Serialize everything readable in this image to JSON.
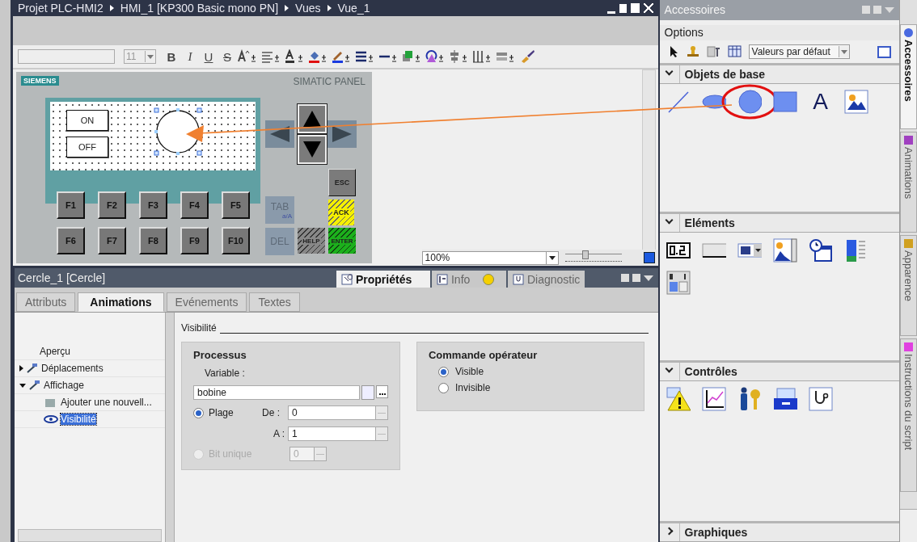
{
  "title_bar": {
    "breadcrumb": [
      "Projet PLC-HMI2",
      "HMI_1 [KP300 Basic mono PN]",
      "Vues",
      "Vue_1"
    ]
  },
  "toolbar": {
    "font_size": "11",
    "text_styles": [
      "B",
      "I",
      "U",
      "S"
    ],
    "tools": [
      {
        "kind": "grow-font"
      },
      {
        "kind": "align-text"
      },
      {
        "kind": "font-color"
      },
      {
        "kind": "fill-color"
      },
      {
        "kind": "line-color"
      },
      {
        "kind": "line-width"
      },
      {
        "kind": "line-style"
      },
      {
        "kind": "layer"
      },
      {
        "kind": "rotate"
      },
      {
        "kind": "align"
      },
      {
        "kind": "distribute"
      },
      {
        "kind": "size"
      },
      {
        "kind": "brush"
      }
    ]
  },
  "hmi_panel": {
    "brand": "SIEMENS",
    "model": "SIMATIC PANEL",
    "screen_buttons": [
      "ON",
      "OFF"
    ],
    "circle_selected": true,
    "function_keys": [
      "F1",
      "F2",
      "F3",
      "F4",
      "F5",
      "F6",
      "F7",
      "F8",
      "F9",
      "F10"
    ],
    "keys": [
      {
        "kind": "esc",
        "label": "ESC"
      },
      {
        "kind": "ack",
        "label": "ACK"
      },
      {
        "kind": "tab",
        "label": "TAB",
        "sub": "a/A"
      },
      {
        "kind": "del",
        "label": "DEL"
      },
      {
        "kind": "help",
        "label": "HELP"
      },
      {
        "kind": "enter",
        "label": "ENTER"
      }
    ]
  },
  "zoom": {
    "value": "100%",
    "level": 0.35
  },
  "properties": {
    "object": "Cercle_1 [Cercle]",
    "panel_tabs": [
      {
        "label": "Propriétés",
        "selected": true
      },
      {
        "label": "Info",
        "selected": false
      },
      {
        "label": "Diagnostic",
        "selected": false
      }
    ],
    "tabs": [
      {
        "label": "Attributs",
        "selected": false
      },
      {
        "label": "Animations",
        "selected": true
      },
      {
        "label": "Evénements",
        "selected": false
      },
      {
        "label": "Textes",
        "selected": false
      }
    ],
    "tree": [
      {
        "label": "Aperçu",
        "selected": false
      },
      {
        "label": "Déplacements",
        "selected": false,
        "expanded": false
      },
      {
        "label": "Affichage",
        "selected": false,
        "expanded": true,
        "children": [
          {
            "label": "Ajouter une nouvell...",
            "selected": false
          },
          {
            "label": "Visibilité",
            "selected": true
          }
        ]
      }
    ],
    "section_title": "Visibilité",
    "process": {
      "title": "Processus",
      "variable_label": "Variable :",
      "variable": "bobine",
      "from_label": "De :",
      "from": "0",
      "to_label": "A :",
      "to": "1",
      "bit": "0",
      "options": [
        {
          "label": "Plage",
          "selected": true,
          "disabled": false
        },
        {
          "label": "Bit unique",
          "selected": false,
          "disabled": true
        }
      ]
    },
    "operator_control": {
      "title": "Commande opérateur",
      "options": [
        {
          "label": "Visible",
          "selected": true
        },
        {
          "label": "Invisible",
          "selected": false
        }
      ]
    }
  },
  "accessories": {
    "title": "Accessoires",
    "options_label": "Options",
    "style_select": "Valeurs par défaut",
    "drag_arrow": true,
    "sections": [
      {
        "title": "Objets de base",
        "expanded": true,
        "items": [
          {
            "kind": "line"
          },
          {
            "kind": "ellipse"
          },
          {
            "kind": "circle",
            "highlighted": true
          },
          {
            "kind": "rectangle"
          },
          {
            "kind": "text",
            "glyph": "A"
          },
          {
            "kind": "picture"
          }
        ]
      },
      {
        "title": "Eléments",
        "expanded": true,
        "items": [
          {
            "kind": "io-field"
          },
          {
            "kind": "button"
          },
          {
            "kind": "symbolic-io"
          },
          {
            "kind": "graphic-io"
          },
          {
            "kind": "date-time"
          },
          {
            "kind": "bar"
          },
          {
            "kind": "switch"
          }
        ]
      },
      {
        "title": "Contrôles",
        "expanded": true,
        "items": [
          {
            "kind": "alarm"
          },
          {
            "kind": "trend"
          },
          {
            "kind": "user"
          },
          {
            "kind": "recipe"
          },
          {
            "kind": "diagnostics"
          }
        ]
      },
      {
        "title": "Graphiques",
        "expanded": false
      }
    ]
  },
  "side_tabs": [
    {
      "label": "Accessoires",
      "selected": true
    },
    {
      "label": "Animations",
      "selected": false
    },
    {
      "label": "Apparence",
      "selected": false
    },
    {
      "label": "Instructions du script",
      "selected": false
    }
  ]
}
